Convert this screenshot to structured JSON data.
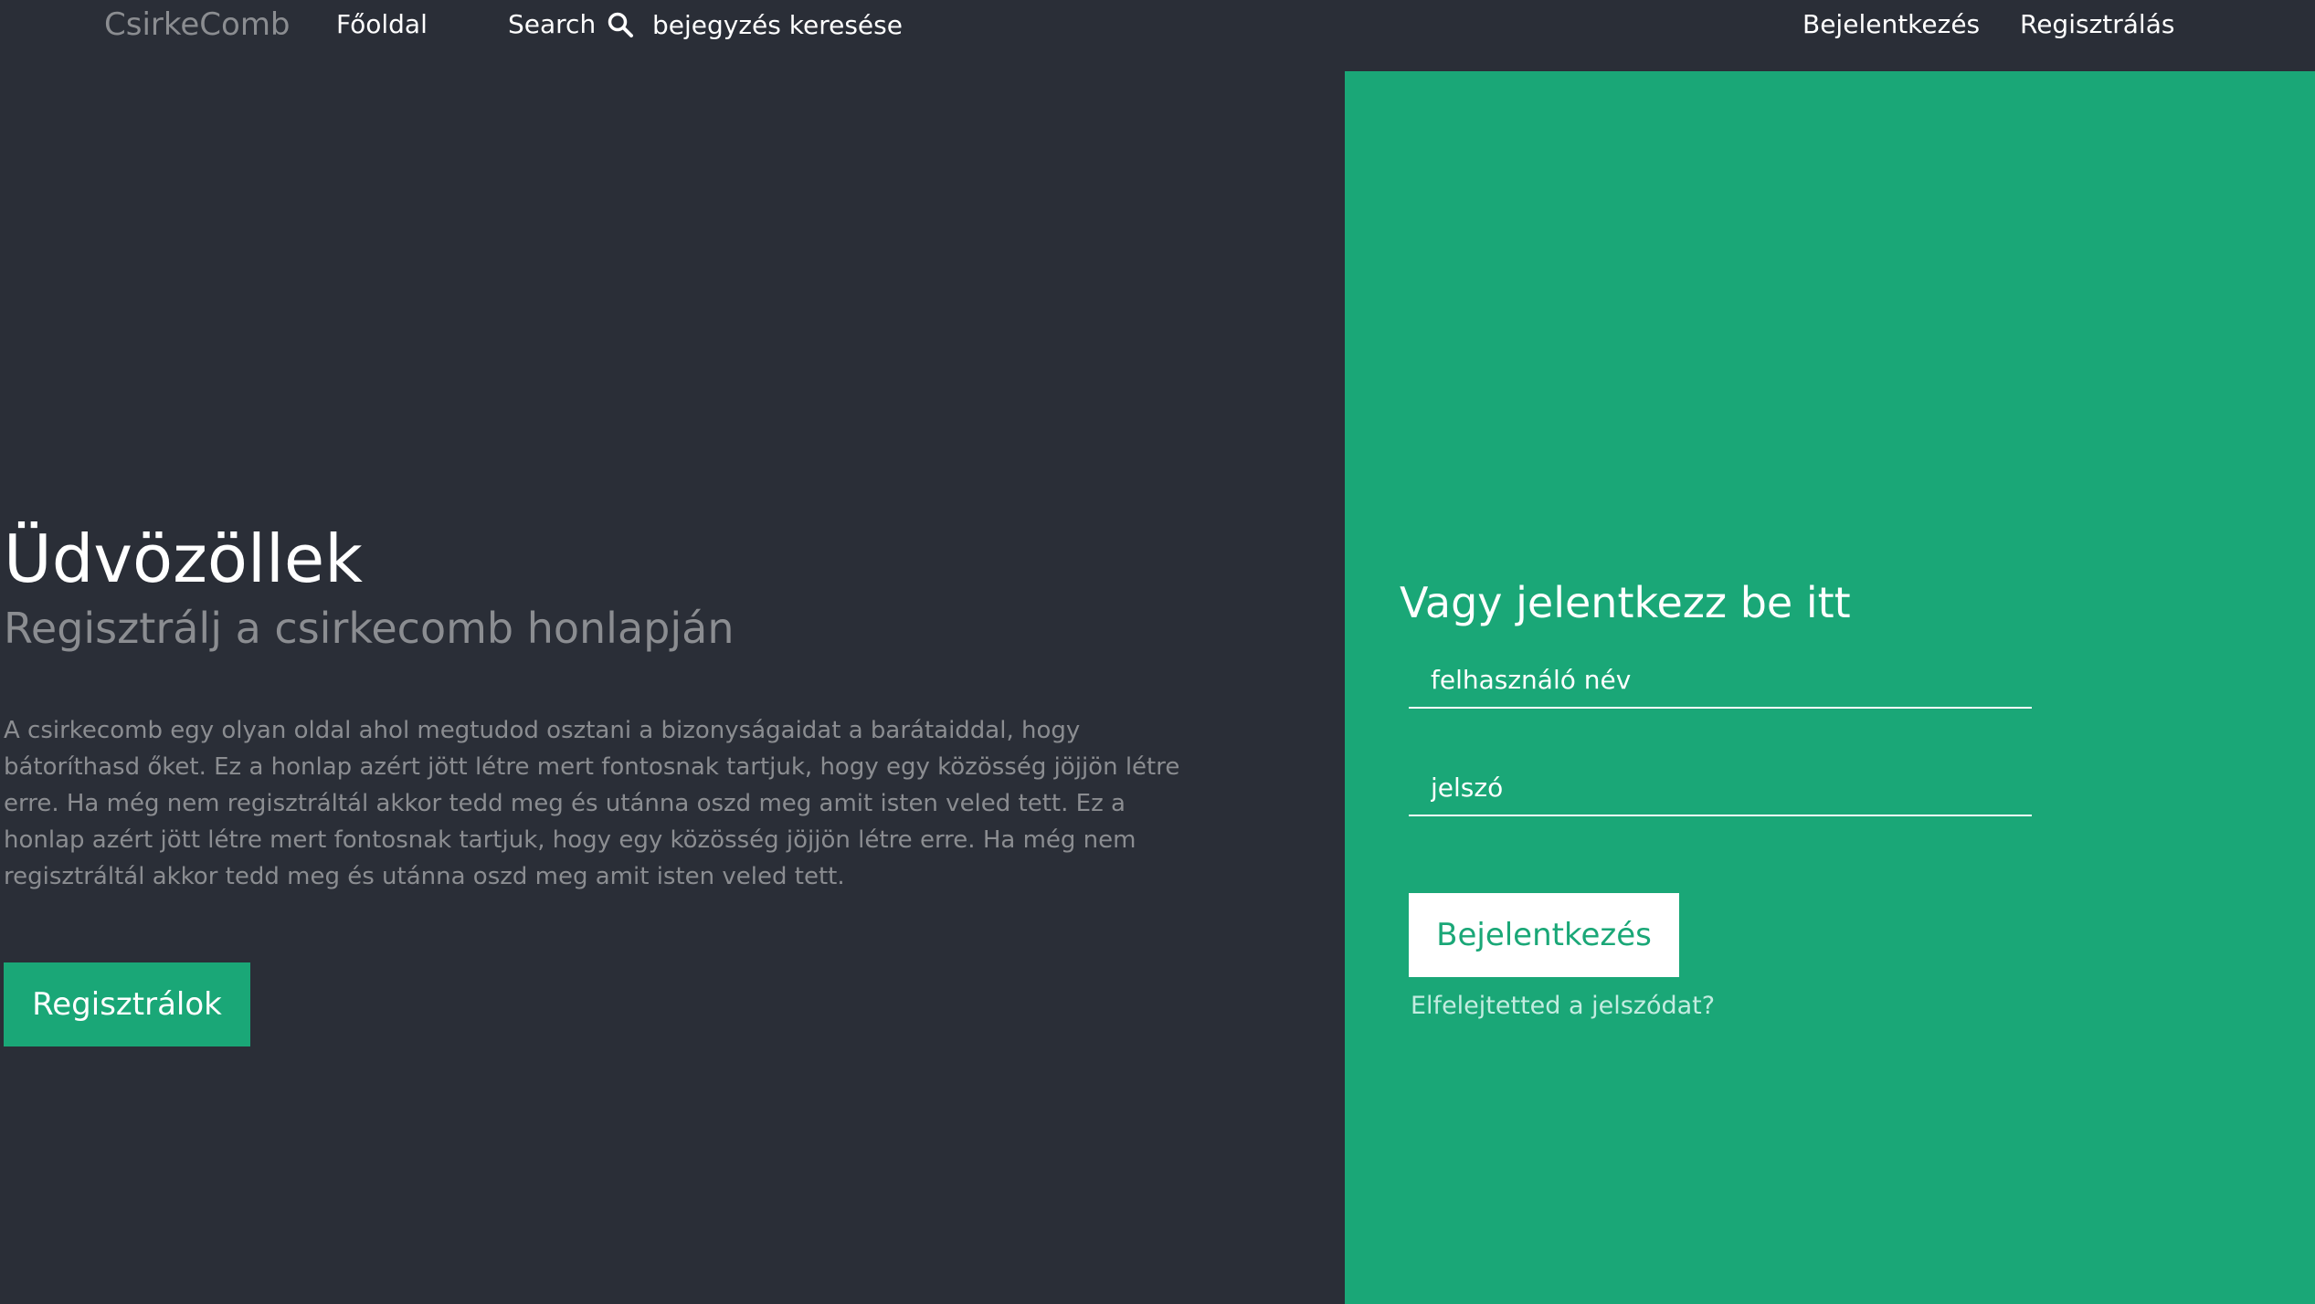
{
  "navbar": {
    "brand": "CsirkeComb",
    "home_label": "Főoldal",
    "search_label": "Search",
    "search_icon": "search-icon",
    "search_placeholder": "bejegyzés keresése",
    "login_label": "Bejelentkezés",
    "register_label": "Regisztrálás"
  },
  "hero": {
    "title": "Üdvözöllek",
    "subtitle": "Regisztrálj a csirkecomb honlapján",
    "text": "A csirkecomb egy olyan oldal ahol megtudod osztani a bizonyságaidat a barátaiddal, hogy bátoríthasd őket. Ez a honlap azért jött létre mert fontosnak tartjuk, hogy egy közösség jöjjön létre erre. Ha még nem regisztráltál akkor tedd meg és utánna oszd meg amit isten veled tett. Ez a honlap azért jött létre mert fontosnak tartjuk, hogy egy közösség jöjjön létre erre. Ha még nem regisztráltál akkor tedd meg és utánna oszd meg amit isten veled tett.",
    "register_button": "Regisztrálok"
  },
  "login_panel": {
    "heading": "Vagy jelentkezz be itt",
    "username_placeholder": "felhasználó név",
    "password_placeholder": "jelszó",
    "login_button": "Bejelentkezés",
    "forgot_link": "Elfelejtetted a jelszódat?"
  },
  "colors": {
    "background": "#2a2e37",
    "accent": "#1aa777",
    "muted_text": "#8b8d91",
    "text": "#ffffff"
  }
}
